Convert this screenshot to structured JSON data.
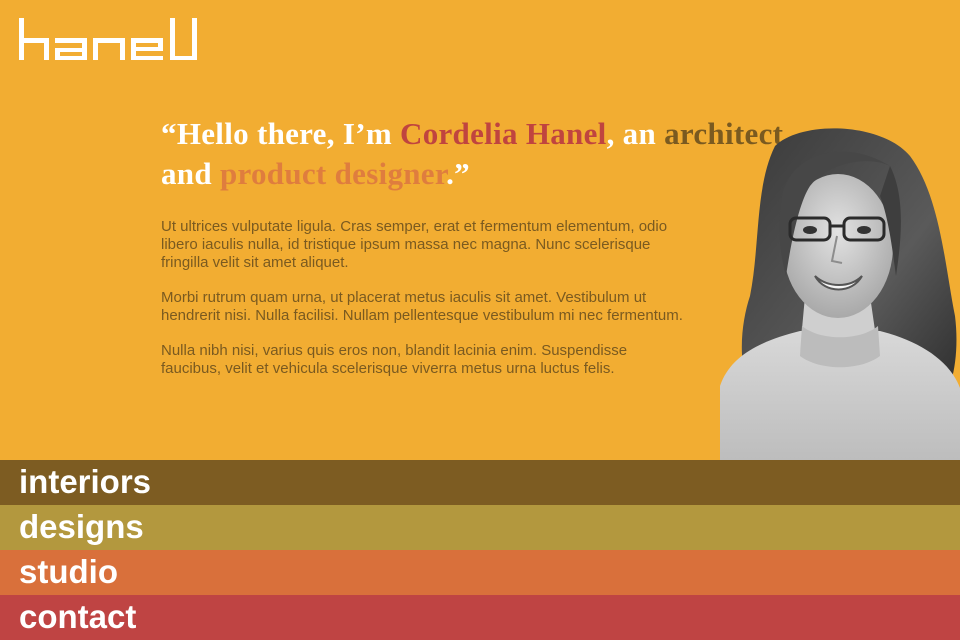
{
  "brand": {
    "logo_text": "hanel",
    "logo_color": "#ffffff"
  },
  "intro": {
    "quote_open": "“",
    "greeting": "Hello there, I’m ",
    "name": "Cordelia Hanel",
    "comma_an": ", an ",
    "role1": "architect",
    "and": " and ",
    "role2": "product designer",
    "quote_close": ".”"
  },
  "paragraphs": [
    "Ut ultrices vulputate ligula. Cras semper, erat et fermentum elementum, odio libero iaculis nulla, id tristique ipsum massa nec magna. Nunc scelerisque fringilla velit sit amet aliquet.",
    "Morbi rutrum quam urna, ut placerat metus iaculis sit amet. Vestibulum ut hendrerit nisi. Nulla facilisi. Nullam pellentesque vestibulum mi nec fermentum.",
    "Nulla nibh nisi, varius quis eros non, blandit lacinia enim. Suspendisse faucibus, velit et vehicula scelerisque viverra metus urna luctus felis."
  ],
  "nav": [
    {
      "label": "interiors",
      "color": "#7d5c22"
    },
    {
      "label": "designs",
      "color": "#b3983e"
    },
    {
      "label": "studio",
      "color": "#d9703b"
    },
    {
      "label": "contact",
      "color": "#bf4443"
    }
  ],
  "colors": {
    "background": "#f2ad32",
    "name_accent": "#c0443f",
    "architect_accent": "#7a5a20",
    "product_accent": "#df7d3e",
    "body_text": "#7a5a20"
  }
}
